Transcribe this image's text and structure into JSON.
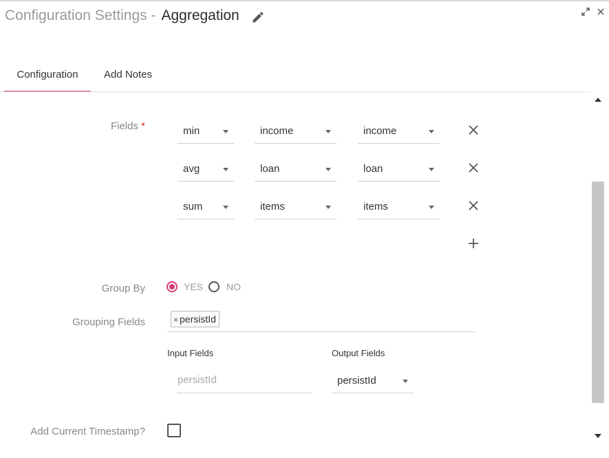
{
  "header": {
    "title_prefix": "Configuration Settings -",
    "title_name": "Aggregation"
  },
  "tabs": [
    {
      "label": "Configuration",
      "active": true
    },
    {
      "label": "Add Notes",
      "active": false
    }
  ],
  "form": {
    "fields_label": "Fields",
    "required_mark": "*",
    "fields_rows": [
      {
        "function": "min",
        "input": "income",
        "output": "income"
      },
      {
        "function": "avg",
        "input": "loan",
        "output": "loan"
      },
      {
        "function": "sum",
        "input": "items",
        "output": "items"
      }
    ],
    "group_by_label": "Group By",
    "group_by_options": [
      "YES",
      "NO"
    ],
    "group_by_selected": "YES",
    "grouping_fields_label": "Grouping Fields",
    "grouping_fields_chip": "persistId",
    "chip_remove": "×",
    "input_fields_label": "Input Fields",
    "output_fields_label": "Output Fields",
    "input_fields_value": "persistId",
    "output_fields_value": "persistId",
    "timestamp_label": "Add Current Timestamp?"
  },
  "colors": {
    "accent": "#d63b75",
    "required": "#d32f2f"
  }
}
